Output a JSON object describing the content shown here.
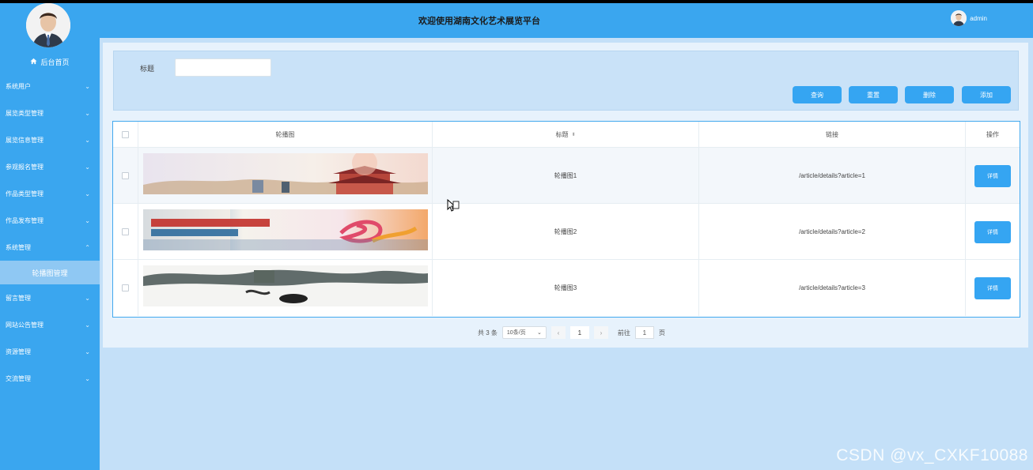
{
  "header": {
    "title": "欢迎使用湖南文化艺术展览平台",
    "username": "admin"
  },
  "sidebar": {
    "home_label": "后台首页",
    "items": [
      {
        "label": "系统用户"
      },
      {
        "label": "展览类型管理"
      },
      {
        "label": "展览信息管理"
      },
      {
        "label": "参观报名管理"
      },
      {
        "label": "作品类型管理"
      },
      {
        "label": "作品发布管理"
      },
      {
        "label": "系统管理",
        "expanded": true,
        "children": [
          {
            "label": "轮播图管理"
          }
        ]
      },
      {
        "label": "留言管理"
      },
      {
        "label": "网站公告管理"
      },
      {
        "label": "资源管理"
      },
      {
        "label": "交流管理"
      }
    ]
  },
  "search": {
    "label": "标题",
    "value": ""
  },
  "buttons": {
    "query": "查询",
    "reset": "重置",
    "delete": "删除",
    "add": "添加"
  },
  "table": {
    "columns": [
      "轮播图",
      "标题",
      "链接",
      "操作"
    ],
    "rows": [
      {
        "title": "轮播图1",
        "link": "/article/details?article=1",
        "action": "详情"
      },
      {
        "title": "轮播图2",
        "link": "/article/details?article=2",
        "action": "详情"
      },
      {
        "title": "轮播图3",
        "link": "/article/details?article=3",
        "action": "详情"
      }
    ]
  },
  "pagination": {
    "total": "共 3 条",
    "page_size": "10条/页",
    "current": "1",
    "goto_prefix": "前往",
    "goto_value": "1",
    "goto_suffix": "页"
  },
  "watermark": "CSDN @vx_CXKF10088",
  "colors": {
    "primary": "#3aa6ef",
    "button": "#35a5f2"
  }
}
